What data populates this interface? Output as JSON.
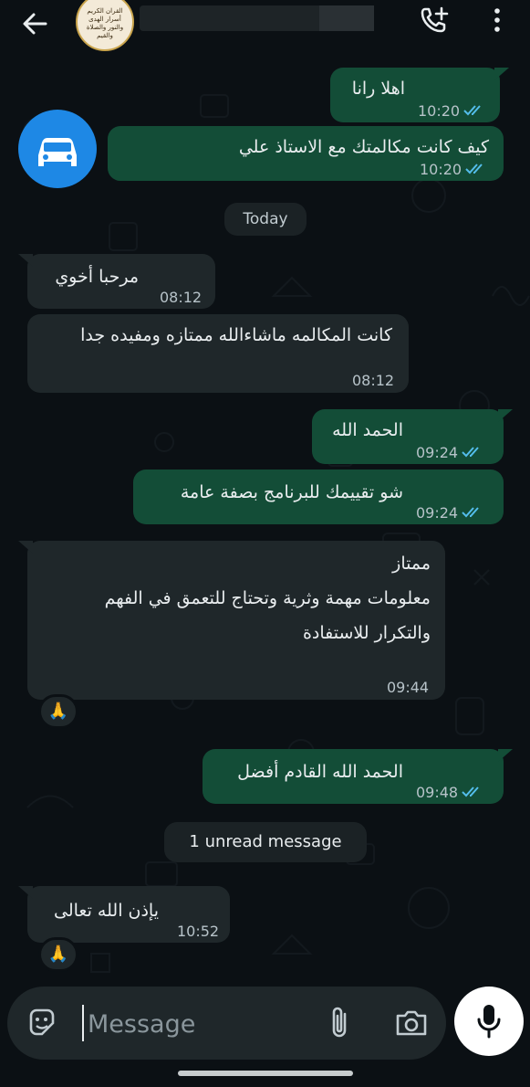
{
  "header": {
    "contact_avatar_text": "القران الكريم\nأسرار الهدى\nوالنور والصلاة\nوالقيم",
    "back_icon": "arrow-left-icon",
    "call_icon": "phone-add-icon",
    "menu_icon": "more-vertical-icon"
  },
  "messages": [
    {
      "text": "اهلا رانا",
      "time": "10:20",
      "dir": "out"
    },
    {
      "text": "كيف كانت مكالمتك مع الاستاذ علي",
      "time": "10:20",
      "dir": "out"
    },
    {
      "text": "مرحبا أخوي",
      "time": "08:12",
      "dir": "in"
    },
    {
      "text": "كانت المكالمه ماشاءالله ممتازه ومفيده جدا",
      "time": "08:12",
      "dir": "in"
    },
    {
      "text": "الحمد الله",
      "time": "09:24",
      "dir": "out"
    },
    {
      "text": "شو تقييمك للبرنامج بصفة عامة",
      "time": "09:24",
      "dir": "out"
    },
    {
      "lines": [
        "ممتاز",
        "معلومات مهمة وثرية وتحتاج للتعمق في الفهم",
        "والتكرار للاستفادة"
      ],
      "time": "09:44",
      "dir": "in",
      "reaction": "🙏"
    },
    {
      "text": "الحمد الله القادم أفضل",
      "time": "09:48",
      "dir": "out"
    },
    {
      "text": "يإذن الله تعالى",
      "time": "10:52",
      "dir": "in",
      "reaction": "🙏"
    }
  ],
  "date_divider": "Today",
  "unread_divider": "1 unread message",
  "composer": {
    "placeholder": "Message"
  },
  "colors": {
    "out_bubble": "#134d37",
    "in_bubble": "#1f272a",
    "tick_read": "#53bdeb"
  }
}
